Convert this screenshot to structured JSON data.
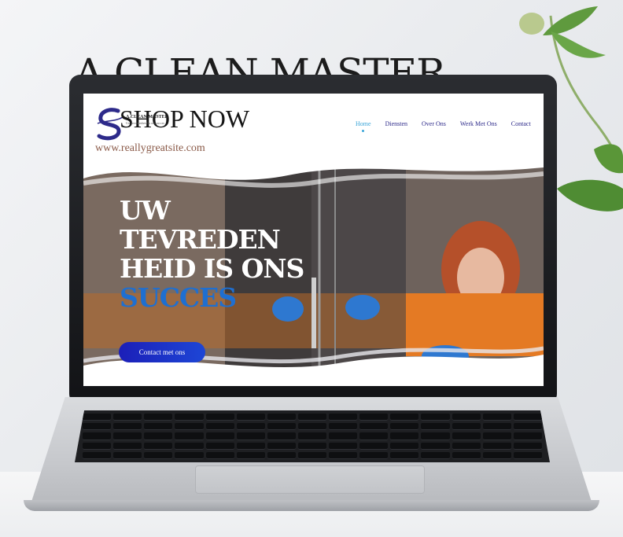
{
  "poster": {
    "headline": "A.CLEAN MASTER"
  },
  "website": {
    "logo": {
      "text": "SHOP NOW",
      "tagline_line1": "A.CLEAN MASTER",
      "tagline_line2": "Uw tevredenheid is ons succes"
    },
    "url": "www.reallygreatsite.com",
    "nav": {
      "items": [
        {
          "label": "Home",
          "active": true
        },
        {
          "label": "Diensten",
          "active": false
        },
        {
          "label": "Over Ons",
          "active": false
        },
        {
          "label": "Werk Met Ons",
          "active": false
        },
        {
          "label": "Contact",
          "active": false
        }
      ]
    },
    "hero": {
      "title_line1": "UW",
      "title_line2": "TEVREDEN",
      "title_line3": "HEID IS ONS",
      "title_accent": "SUCCES",
      "cta_label": "Contact met ons"
    }
  },
  "colors": {
    "accent_blue": "#1f6fd0",
    "nav_text": "#2d2a8a",
    "nav_active": "#3aa5d8",
    "url_text": "#8a5a48",
    "cta_bg": "#1c1fb8"
  },
  "icons": {
    "logo_mark": "swirl-s-logo-icon"
  }
}
